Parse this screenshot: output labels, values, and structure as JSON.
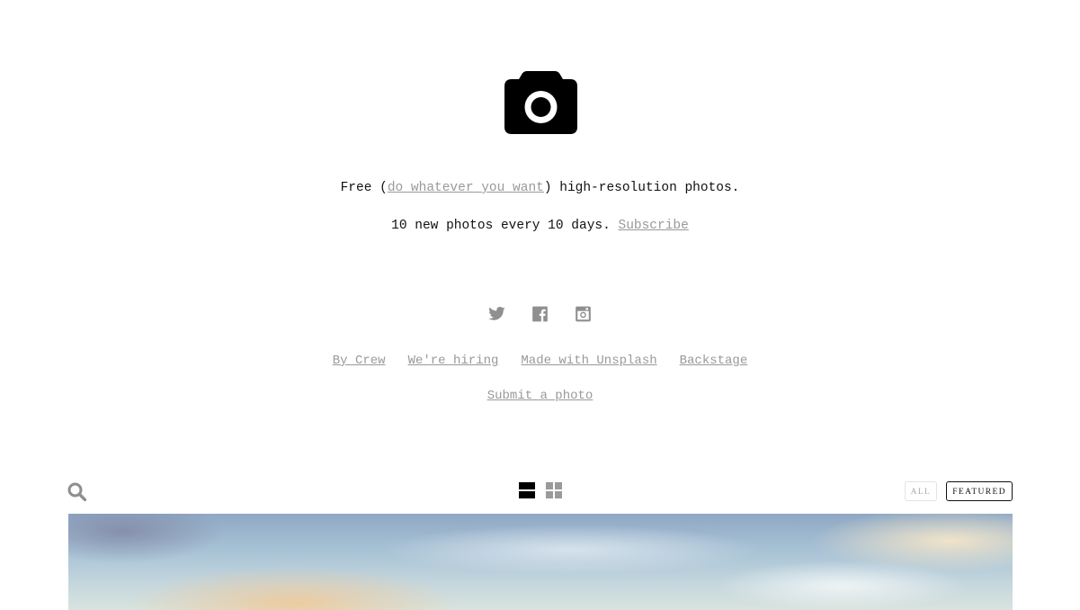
{
  "brand": {
    "logo_icon": "camera-icon"
  },
  "tagline": {
    "prefix": "Free (",
    "link": "do whatever you want",
    "suffix": ") high-resolution photos."
  },
  "subscribe": {
    "text": "10 new photos every 10 days. ",
    "link": "Subscribe"
  },
  "social": [
    {
      "icon": "twitter-icon"
    },
    {
      "icon": "facebook-icon"
    },
    {
      "icon": "instagram-icon"
    }
  ],
  "footer_links": [
    "By Crew",
    "We're hiring",
    "Made with Unsplash",
    "Backstage"
  ],
  "submit_link": "Submit a photo",
  "toolbar": {
    "search_icon": "search-icon",
    "view_modes": [
      "single-column-view-icon",
      "grid-view-icon"
    ],
    "filters": {
      "all": "ALL",
      "featured": "FEATURED",
      "selected": "featured"
    }
  },
  "colors": {
    "text": "#111111",
    "muted": "#999999",
    "icon_gray": "#8f8f8f"
  }
}
